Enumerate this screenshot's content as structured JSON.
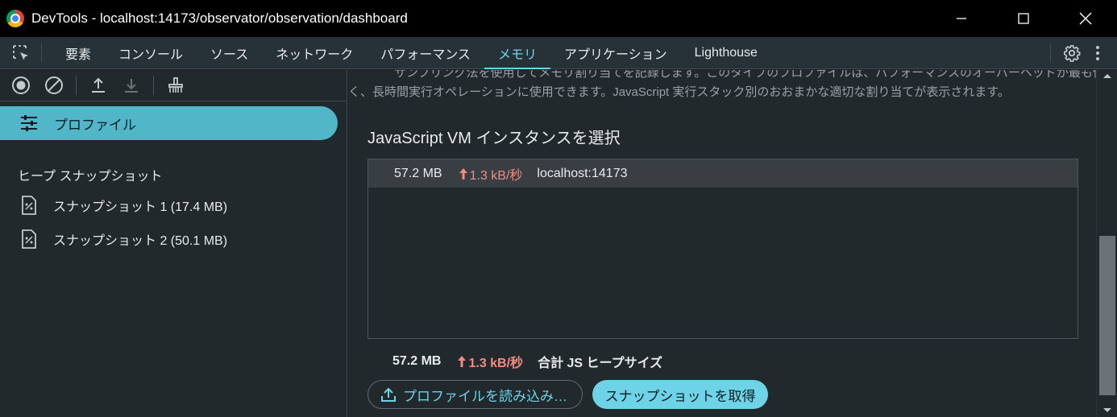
{
  "window": {
    "title": "DevTools - localhost:14173/observator/observation/dashboard",
    "controls": [
      "minimize-icon",
      "maximize-icon",
      "close-icon"
    ]
  },
  "tabs": [
    {
      "label": "要素",
      "active": false
    },
    {
      "label": "コンソール",
      "active": false
    },
    {
      "label": "ソース",
      "active": false
    },
    {
      "label": "ネットワーク",
      "active": false
    },
    {
      "label": "パフォーマンス",
      "active": false
    },
    {
      "label": "メモリ",
      "active": true
    },
    {
      "label": "アプリケーション",
      "active": false
    },
    {
      "label": "Lighthouse",
      "active": false
    }
  ],
  "toolbar_icons": [
    "record-icon",
    "clear-icon",
    "upload-icon",
    "download-icon",
    "collect-garbage-icon"
  ],
  "sidebar": {
    "profile_item": "プロファイル",
    "heap_section_title": "ヒープ スナップショット",
    "snapshots": [
      {
        "label": "スナップショット 1 (17.4 MB)"
      },
      {
        "label": "スナップショット 2 (50.1 MB)"
      }
    ]
  },
  "main": {
    "description_line1": "サンプリング法を使用してメモリ割り当てを記録します。このタイプのプロファイルは、パフォーマンスのオーバーヘッドが最も低",
    "description_line2": "く、長時間実行オペレーションに使用できます。JavaScript 実行スタック別のおおまかな適切な割り当てが表示されます。",
    "vm_heading": "JavaScript VM インスタンスを選択",
    "instances": [
      {
        "size": "57.2 MB",
        "rate": "1.3 kB/秒",
        "host": "localhost:14173"
      }
    ],
    "total": {
      "size": "57.2 MB",
      "rate": "1.3 kB/秒",
      "label": "合計 JS ヒープサイズ"
    },
    "load_button": "プロファイルを読み込み…",
    "snapshot_button": "スナップショットを取得"
  },
  "colors": {
    "accent": "#6fd3e8",
    "selected_item_bg": "#52b6c9",
    "rate_color": "#f28b82",
    "panel_bg": "#22292d",
    "tabbar_bg": "#263238"
  }
}
